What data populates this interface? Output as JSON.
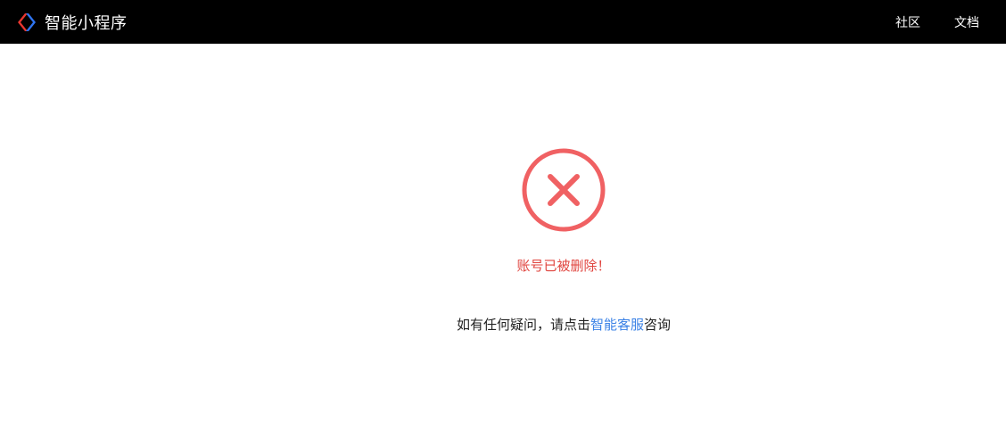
{
  "header": {
    "title": "智能小程序",
    "logo_icon": "smart-miniprogram-logo-icon",
    "logo_colors": {
      "red": "#e8362f",
      "blue": "#2f74f0"
    },
    "nav": [
      {
        "label": "社区"
      },
      {
        "label": "文档"
      }
    ]
  },
  "status": {
    "icon": "error-x-circle-icon",
    "icon_color": "#f06163",
    "message": "账号已被删除！",
    "message_color": "#e0453f"
  },
  "help": {
    "prefix": "如有任何疑问，请点击",
    "link": "智能客服",
    "suffix": "咨询",
    "link_color": "#3b82e6"
  }
}
